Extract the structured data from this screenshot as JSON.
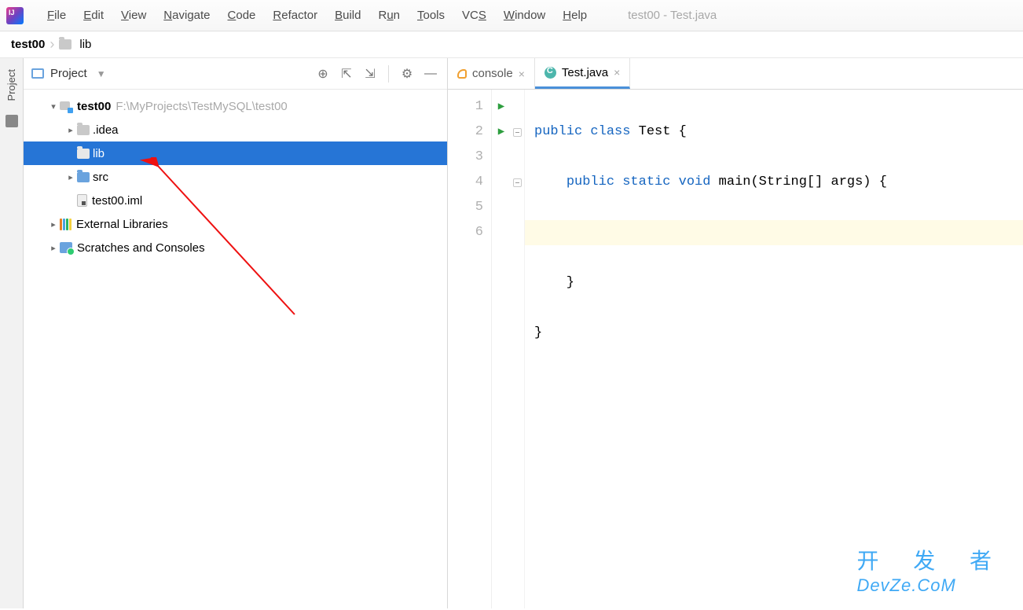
{
  "window": {
    "title": "test00 - Test.java"
  },
  "menu": {
    "file": "File",
    "edit": "Edit",
    "view": "View",
    "navigate": "Navigate",
    "code": "Code",
    "refactor": "Refactor",
    "build": "Build",
    "run": "Run",
    "tools": "Tools",
    "vcs": "VCS",
    "window": "Window",
    "help": "Help"
  },
  "breadcrumb": {
    "project": "test00",
    "folder": "lib"
  },
  "sidebar": {
    "label": "Project"
  },
  "panel": {
    "title": "Project"
  },
  "tree": {
    "root": {
      "name": "test00",
      "path": "F:\\MyProjects\\TestMySQL\\test00"
    },
    "idea": ".idea",
    "lib": "lib",
    "src": "src",
    "iml": "test00.iml",
    "ext": "External Libraries",
    "scratch": "Scratches and Consoles"
  },
  "tabs": {
    "console": "console",
    "test": "Test.java"
  },
  "code": {
    "l1a": "public",
    "l1b": "class",
    "l1c": "Test {",
    "l2a": "public",
    "l2b": "static",
    "l2c": "void",
    "l2d": "main",
    "l2e": "(String[] args) {",
    "l3": "",
    "l4": "    }",
    "l5": "}",
    "lines": [
      "1",
      "2",
      "3",
      "4",
      "5",
      "6"
    ]
  },
  "watermark": {
    "l1": "开 发 者",
    "l2": "DevZe.CoM"
  }
}
